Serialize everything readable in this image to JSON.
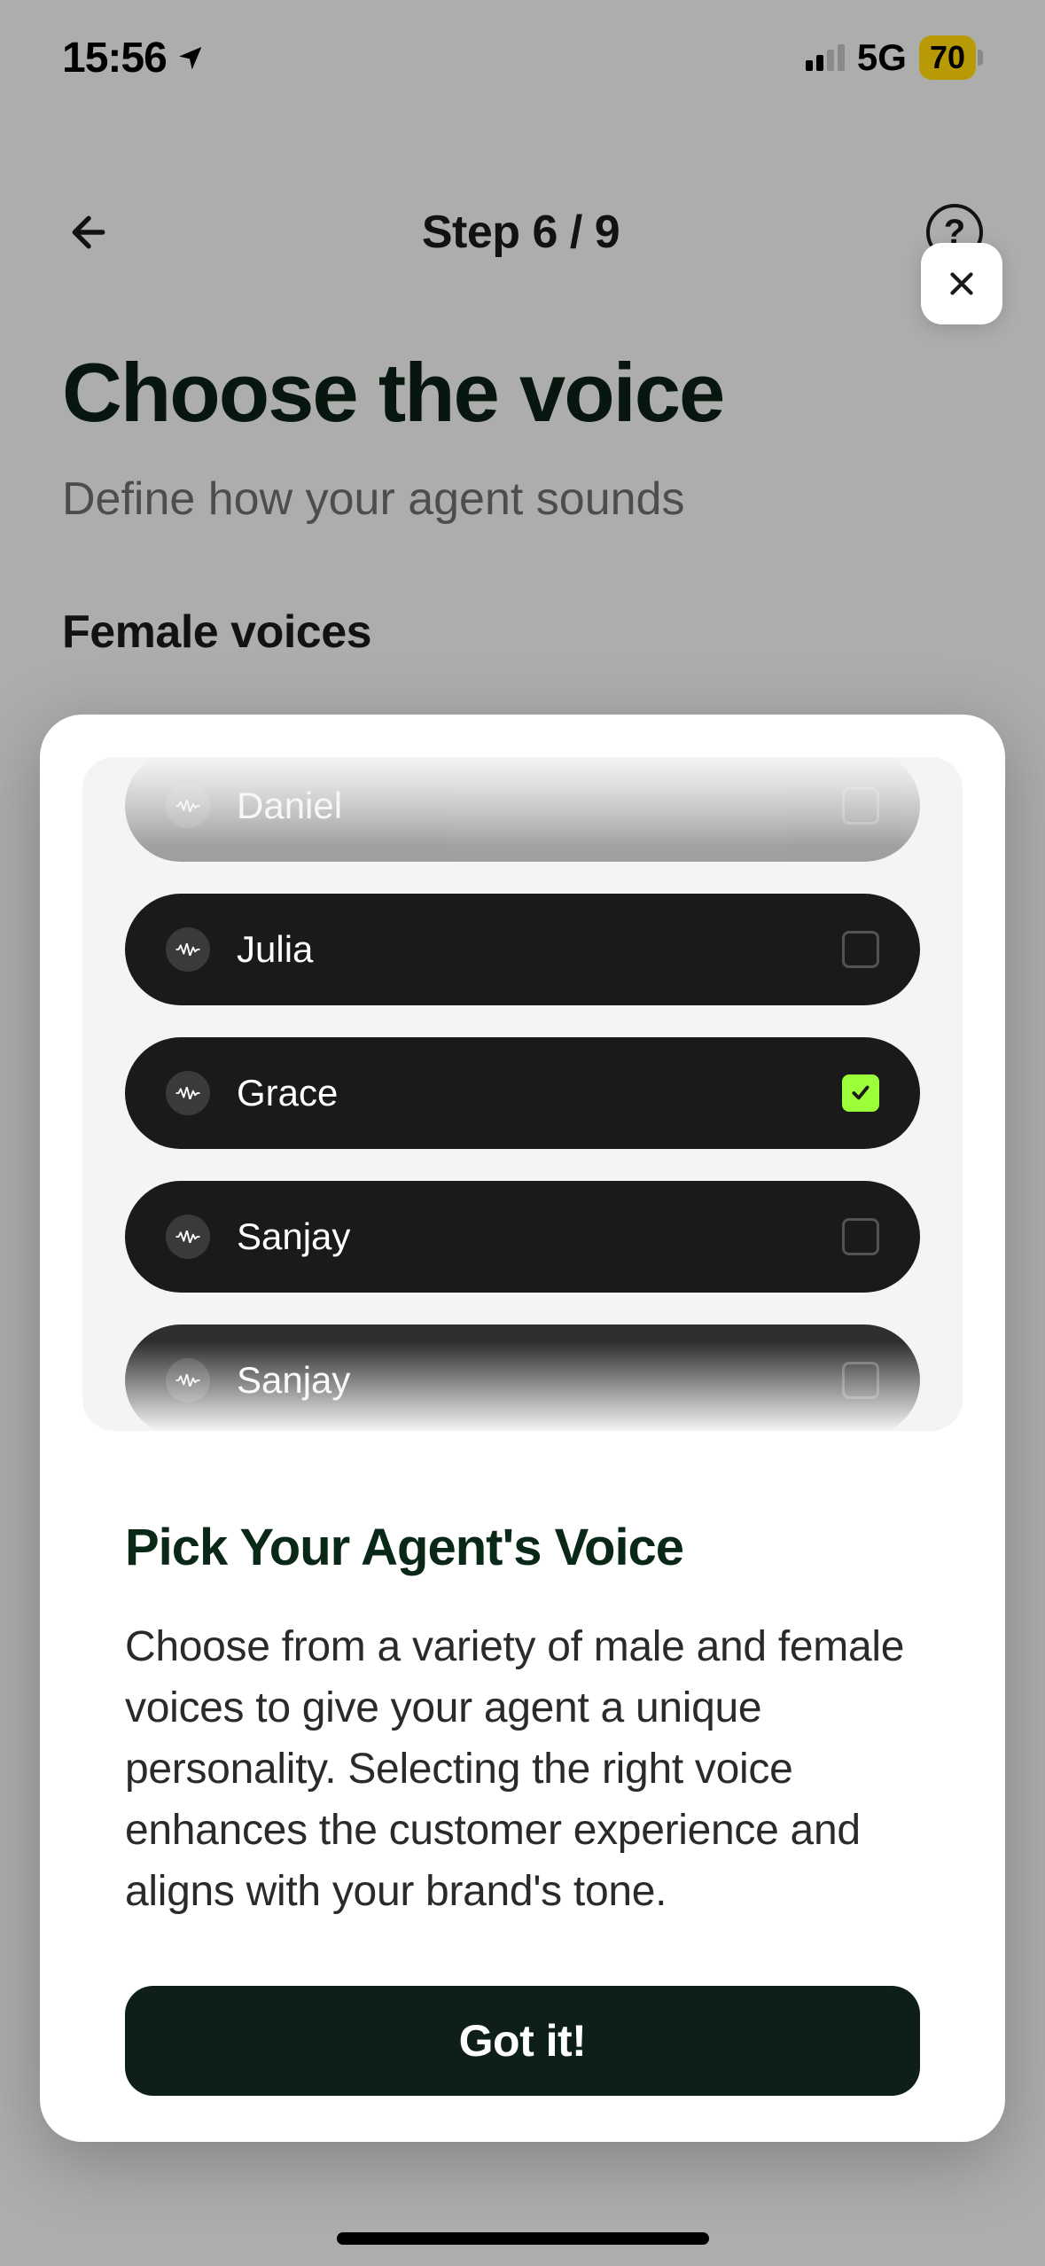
{
  "status": {
    "time": "15:56",
    "network": "5G",
    "battery": "70"
  },
  "nav": {
    "step_label": "Step 6 / 9"
  },
  "page": {
    "title": "Choose the voice",
    "subtitle": "Define how your agent sounds",
    "section": "Female voices"
  },
  "modal": {
    "voices": [
      {
        "name": "Daniel",
        "selected": false
      },
      {
        "name": "Julia",
        "selected": false
      },
      {
        "name": "Grace",
        "selected": true
      },
      {
        "name": "Sanjay",
        "selected": false
      },
      {
        "name": "Sanjay",
        "selected": false
      }
    ],
    "title": "Pick Your Agent's Voice",
    "body": "Choose from a variety of male and female voices to give your agent a unique personality. Selecting the right voice enhances the customer experience and aligns with your brand's tone.",
    "button": "Got it!"
  }
}
